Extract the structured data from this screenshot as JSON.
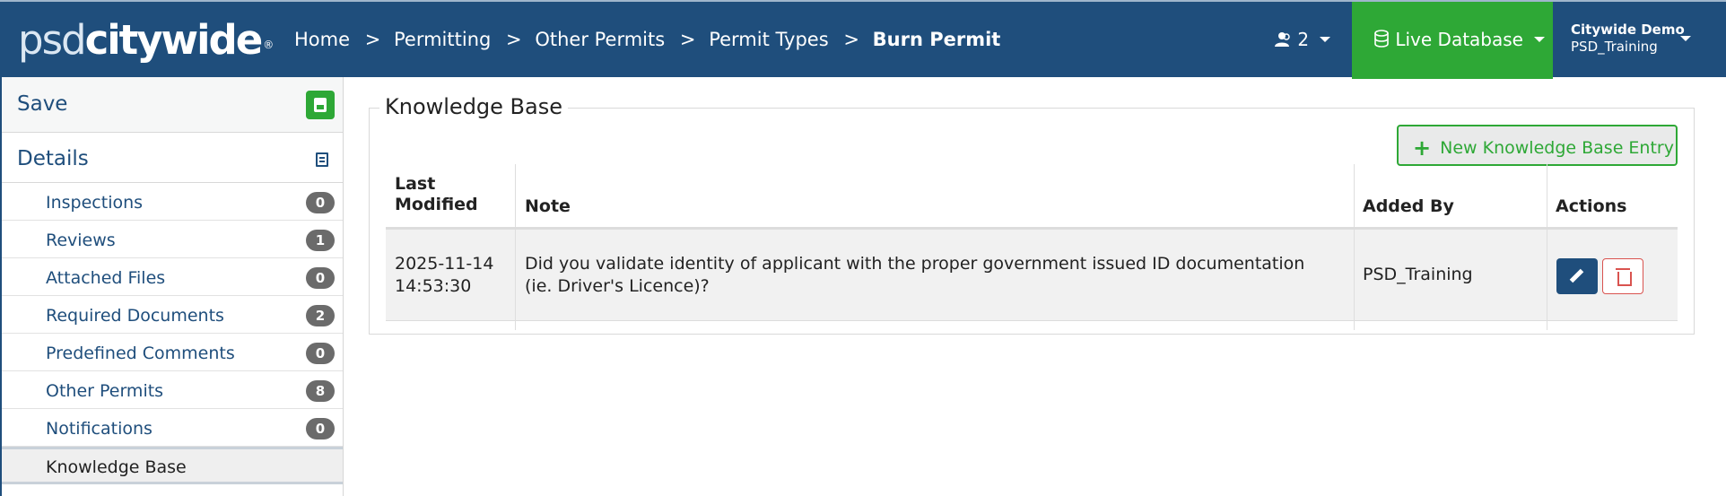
{
  "header": {
    "logo_psd": "psd",
    "logo_citywide": "citywide",
    "logo_reg": "®",
    "breadcrumb": [
      "Home",
      "Permitting",
      "Other Permits",
      "Permit Types",
      "Burn Permit"
    ],
    "breadcrumb_sep": ">",
    "users_count": "2",
    "database_label": "Live Database",
    "account_name": "Citywide Demo",
    "account_user": "PSD_Training"
  },
  "sidebar": {
    "save_label": "Save",
    "details_label": "Details",
    "items": [
      {
        "label": "Inspections",
        "count": "0"
      },
      {
        "label": "Reviews",
        "count": "1"
      },
      {
        "label": "Attached Files",
        "count": "0"
      },
      {
        "label": "Required Documents",
        "count": "2"
      },
      {
        "label": "Predefined Comments",
        "count": "0"
      },
      {
        "label": "Other Permits",
        "count": "8"
      },
      {
        "label": "Notifications",
        "count": "0"
      },
      {
        "label": "Knowledge Base",
        "count": ""
      }
    ]
  },
  "main": {
    "section_title": "Knowledge Base",
    "new_button_label": "New Knowledge Base Entry",
    "table": {
      "headers": {
        "last_modified_line1": "Last",
        "last_modified_line2": "Modified",
        "note": "Note",
        "added_by": "Added By",
        "actions": "Actions"
      },
      "rows": [
        {
          "date": "2025-11-14",
          "time": "14:53:30",
          "note_line1": "Did you validate identity of applicant with the proper government issued ID documentation",
          "note_line2": "(ie. Driver's Licence)?",
          "added_by": "PSD_Training"
        }
      ]
    }
  },
  "colors": {
    "header_bg": "#1f4e7c",
    "live_db_bg": "#2ea836",
    "badge_bg": "#6b6b6b",
    "delete_red": "#d9534f"
  },
  "icons": [
    "users-icon",
    "database-icon",
    "save-icon",
    "details-icon",
    "plus-icon",
    "pencil-icon",
    "trash-icon"
  ]
}
